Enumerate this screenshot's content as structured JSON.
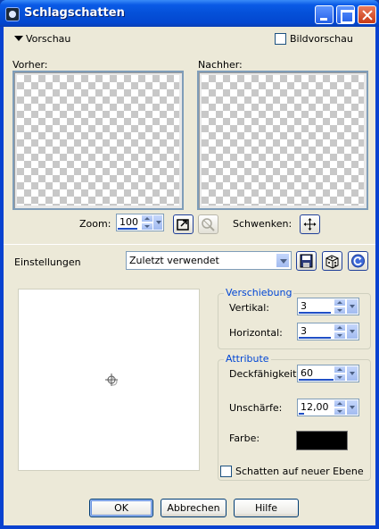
{
  "window": {
    "title": "Schlagschatten"
  },
  "preview": {
    "toggle_label": "Vorschau",
    "image_preview_label": "Bildvorschau",
    "before_label": "Vorher:",
    "after_label": "Nachher:",
    "zoom_label": "Zoom:",
    "zoom_value": "100",
    "pan_label": "Schwenken:"
  },
  "settings": {
    "label": "Einstellungen",
    "preset_value": "Zuletzt verwendet"
  },
  "offset": {
    "title": "Verschiebung",
    "vertical_label": "Vertikal:",
    "vertical_value": "3",
    "horizontal_label": "Horizontal:",
    "horizontal_value": "3"
  },
  "attributes": {
    "title": "Attribute",
    "opacity_label": "Deckfähigkeit:",
    "opacity_value": "60",
    "blur_label": "Unschärfe:",
    "blur_value": "12,00",
    "color_label": "Farbe:",
    "color_hex": "#000000"
  },
  "new_layer_label": "Schatten auf neuer Ebene",
  "buttons": {
    "ok": "OK",
    "cancel": "Abbrechen",
    "help": "Hilfe"
  }
}
